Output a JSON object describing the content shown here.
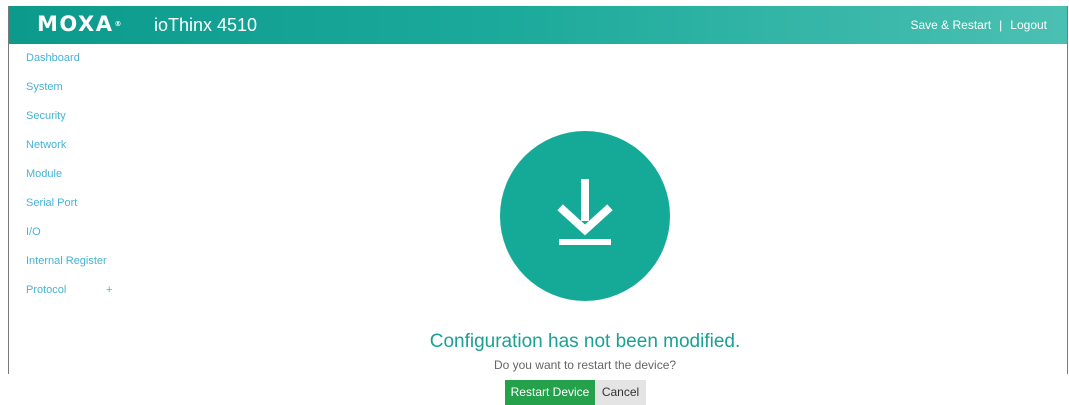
{
  "header": {
    "brand": "MOXA",
    "brand_mark": "®",
    "product": "ioThinx 4510",
    "save_restart": "Save & Restart",
    "separator": "|",
    "logout": "Logout"
  },
  "sidebar": {
    "items": [
      {
        "label": "Dashboard"
      },
      {
        "label": "System"
      },
      {
        "label": "Security"
      },
      {
        "label": "Network"
      },
      {
        "label": "Module"
      },
      {
        "label": "Serial Port"
      },
      {
        "label": "I/O"
      },
      {
        "label": "Internal Register"
      },
      {
        "label": "Protocol",
        "expander": "+"
      }
    ]
  },
  "main": {
    "icon": "download-icon",
    "title": "Configuration has not been modified.",
    "subtitle": "Do you want to restart the device?",
    "restart_label": "Restart Device",
    "cancel_label": "Cancel"
  },
  "colors": {
    "header_start": "#0b9a8c",
    "header_end": "#4bc0b2",
    "accent": "#14aa97",
    "link": "#46b3d6",
    "primary_button": "#24a14a",
    "secondary_button": "#e4e4e4"
  }
}
